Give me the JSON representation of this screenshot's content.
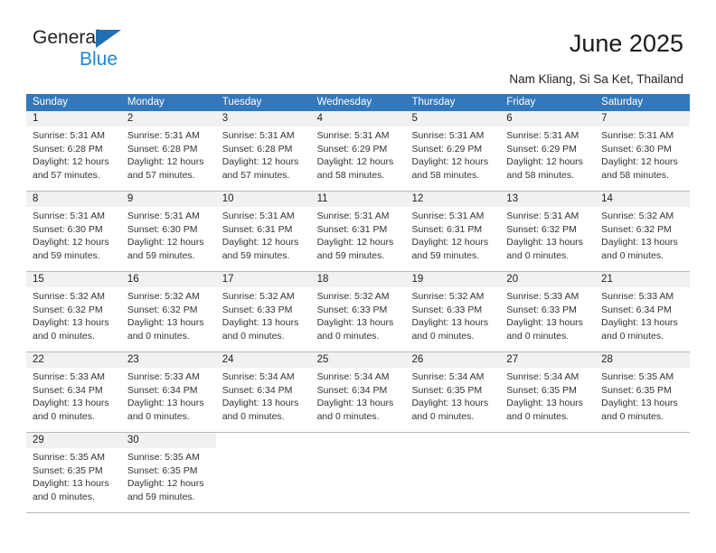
{
  "brand": {
    "name_top": "General",
    "name_bottom": "Blue",
    "triangle_color": "#1f6fb2",
    "blue_color": "#1b87d4"
  },
  "header": {
    "title": "June 2025",
    "location": "Nam Kliang, Si Sa Ket, Thailand"
  },
  "theme": {
    "header_row_bg": "#3378bc",
    "daynum_band_bg": "#f1f1f1",
    "row_border": "#b9b9b9"
  },
  "calendar": {
    "weekday_headers": [
      "Sunday",
      "Monday",
      "Tuesday",
      "Wednesday",
      "Thursday",
      "Friday",
      "Saturday"
    ],
    "weeks": [
      [
        {
          "day": "1",
          "sunrise": "Sunrise: 5:31 AM",
          "sunset": "Sunset: 6:28 PM",
          "daylight1": "Daylight: 12 hours",
          "daylight2": "and 57 minutes."
        },
        {
          "day": "2",
          "sunrise": "Sunrise: 5:31 AM",
          "sunset": "Sunset: 6:28 PM",
          "daylight1": "Daylight: 12 hours",
          "daylight2": "and 57 minutes."
        },
        {
          "day": "3",
          "sunrise": "Sunrise: 5:31 AM",
          "sunset": "Sunset: 6:28 PM",
          "daylight1": "Daylight: 12 hours",
          "daylight2": "and 57 minutes."
        },
        {
          "day": "4",
          "sunrise": "Sunrise: 5:31 AM",
          "sunset": "Sunset: 6:29 PM",
          "daylight1": "Daylight: 12 hours",
          "daylight2": "and 58 minutes."
        },
        {
          "day": "5",
          "sunrise": "Sunrise: 5:31 AM",
          "sunset": "Sunset: 6:29 PM",
          "daylight1": "Daylight: 12 hours",
          "daylight2": "and 58 minutes."
        },
        {
          "day": "6",
          "sunrise": "Sunrise: 5:31 AM",
          "sunset": "Sunset: 6:29 PM",
          "daylight1": "Daylight: 12 hours",
          "daylight2": "and 58 minutes."
        },
        {
          "day": "7",
          "sunrise": "Sunrise: 5:31 AM",
          "sunset": "Sunset: 6:30 PM",
          "daylight1": "Daylight: 12 hours",
          "daylight2": "and 58 minutes."
        }
      ],
      [
        {
          "day": "8",
          "sunrise": "Sunrise: 5:31 AM",
          "sunset": "Sunset: 6:30 PM",
          "daylight1": "Daylight: 12 hours",
          "daylight2": "and 59 minutes."
        },
        {
          "day": "9",
          "sunrise": "Sunrise: 5:31 AM",
          "sunset": "Sunset: 6:30 PM",
          "daylight1": "Daylight: 12 hours",
          "daylight2": "and 59 minutes."
        },
        {
          "day": "10",
          "sunrise": "Sunrise: 5:31 AM",
          "sunset": "Sunset: 6:31 PM",
          "daylight1": "Daylight: 12 hours",
          "daylight2": "and 59 minutes."
        },
        {
          "day": "11",
          "sunrise": "Sunrise: 5:31 AM",
          "sunset": "Sunset: 6:31 PM",
          "daylight1": "Daylight: 12 hours",
          "daylight2": "and 59 minutes."
        },
        {
          "day": "12",
          "sunrise": "Sunrise: 5:31 AM",
          "sunset": "Sunset: 6:31 PM",
          "daylight1": "Daylight: 12 hours",
          "daylight2": "and 59 minutes."
        },
        {
          "day": "13",
          "sunrise": "Sunrise: 5:31 AM",
          "sunset": "Sunset: 6:32 PM",
          "daylight1": "Daylight: 13 hours",
          "daylight2": "and 0 minutes."
        },
        {
          "day": "14",
          "sunrise": "Sunrise: 5:32 AM",
          "sunset": "Sunset: 6:32 PM",
          "daylight1": "Daylight: 13 hours",
          "daylight2": "and 0 minutes."
        }
      ],
      [
        {
          "day": "15",
          "sunrise": "Sunrise: 5:32 AM",
          "sunset": "Sunset: 6:32 PM",
          "daylight1": "Daylight: 13 hours",
          "daylight2": "and 0 minutes."
        },
        {
          "day": "16",
          "sunrise": "Sunrise: 5:32 AM",
          "sunset": "Sunset: 6:32 PM",
          "daylight1": "Daylight: 13 hours",
          "daylight2": "and 0 minutes."
        },
        {
          "day": "17",
          "sunrise": "Sunrise: 5:32 AM",
          "sunset": "Sunset: 6:33 PM",
          "daylight1": "Daylight: 13 hours",
          "daylight2": "and 0 minutes."
        },
        {
          "day": "18",
          "sunrise": "Sunrise: 5:32 AM",
          "sunset": "Sunset: 6:33 PM",
          "daylight1": "Daylight: 13 hours",
          "daylight2": "and 0 minutes."
        },
        {
          "day": "19",
          "sunrise": "Sunrise: 5:32 AM",
          "sunset": "Sunset: 6:33 PM",
          "daylight1": "Daylight: 13 hours",
          "daylight2": "and 0 minutes."
        },
        {
          "day": "20",
          "sunrise": "Sunrise: 5:33 AM",
          "sunset": "Sunset: 6:33 PM",
          "daylight1": "Daylight: 13 hours",
          "daylight2": "and 0 minutes."
        },
        {
          "day": "21",
          "sunrise": "Sunrise: 5:33 AM",
          "sunset": "Sunset: 6:34 PM",
          "daylight1": "Daylight: 13 hours",
          "daylight2": "and 0 minutes."
        }
      ],
      [
        {
          "day": "22",
          "sunrise": "Sunrise: 5:33 AM",
          "sunset": "Sunset: 6:34 PM",
          "daylight1": "Daylight: 13 hours",
          "daylight2": "and 0 minutes."
        },
        {
          "day": "23",
          "sunrise": "Sunrise: 5:33 AM",
          "sunset": "Sunset: 6:34 PM",
          "daylight1": "Daylight: 13 hours",
          "daylight2": "and 0 minutes."
        },
        {
          "day": "24",
          "sunrise": "Sunrise: 5:34 AM",
          "sunset": "Sunset: 6:34 PM",
          "daylight1": "Daylight: 13 hours",
          "daylight2": "and 0 minutes."
        },
        {
          "day": "25",
          "sunrise": "Sunrise: 5:34 AM",
          "sunset": "Sunset: 6:34 PM",
          "daylight1": "Daylight: 13 hours",
          "daylight2": "and 0 minutes."
        },
        {
          "day": "26",
          "sunrise": "Sunrise: 5:34 AM",
          "sunset": "Sunset: 6:35 PM",
          "daylight1": "Daylight: 13 hours",
          "daylight2": "and 0 minutes."
        },
        {
          "day": "27",
          "sunrise": "Sunrise: 5:34 AM",
          "sunset": "Sunset: 6:35 PM",
          "daylight1": "Daylight: 13 hours",
          "daylight2": "and 0 minutes."
        },
        {
          "day": "28",
          "sunrise": "Sunrise: 5:35 AM",
          "sunset": "Sunset: 6:35 PM",
          "daylight1": "Daylight: 13 hours",
          "daylight2": "and 0 minutes."
        }
      ],
      [
        {
          "day": "29",
          "sunrise": "Sunrise: 5:35 AM",
          "sunset": "Sunset: 6:35 PM",
          "daylight1": "Daylight: 13 hours",
          "daylight2": "and 0 minutes."
        },
        {
          "day": "30",
          "sunrise": "Sunrise: 5:35 AM",
          "sunset": "Sunset: 6:35 PM",
          "daylight1": "Daylight: 12 hours",
          "daylight2": "and 59 minutes."
        },
        null,
        null,
        null,
        null,
        null
      ]
    ]
  }
}
